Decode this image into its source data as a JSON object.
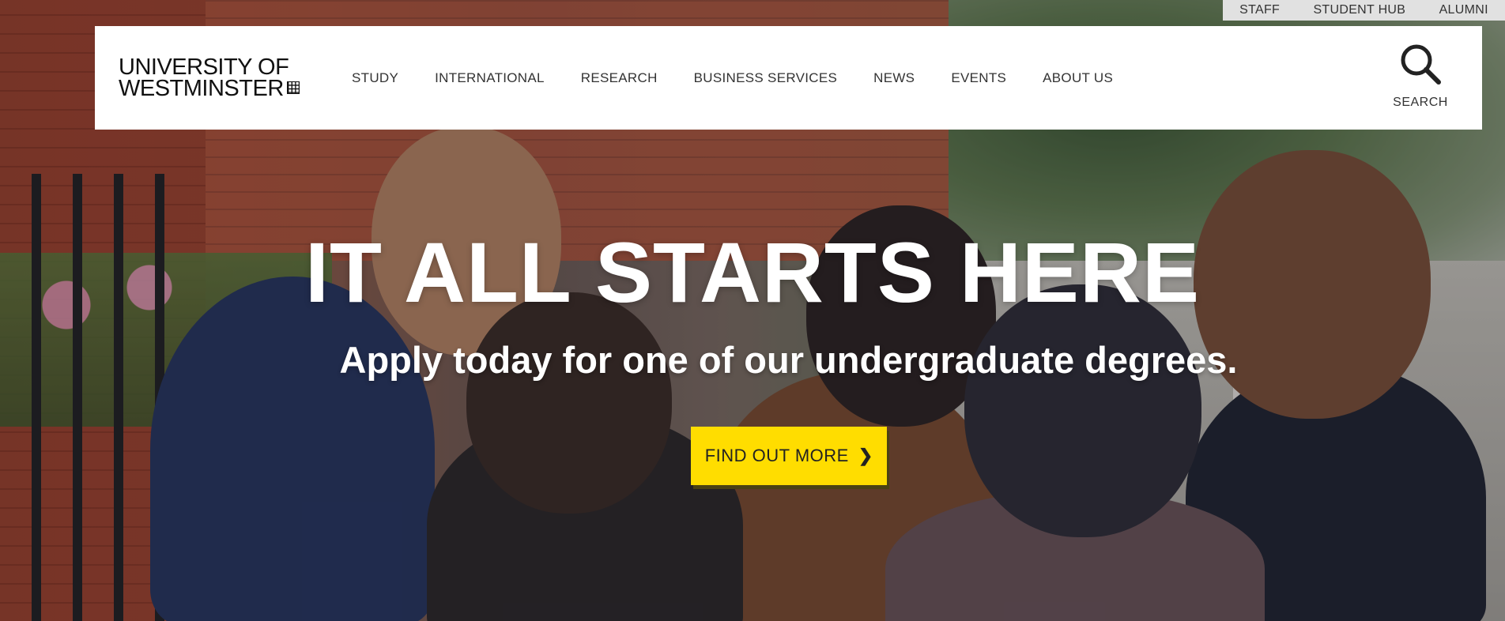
{
  "utility_nav": [
    "STAFF",
    "STUDENT HUB",
    "ALUMNI"
  ],
  "logo": {
    "line1": "UNIVERSITY OF",
    "line2": "WESTMINSTER"
  },
  "main_nav": [
    "STUDY",
    "INTERNATIONAL",
    "RESEARCH",
    "BUSINESS SERVICES",
    "NEWS",
    "EVENTS",
    "ABOUT US"
  ],
  "search": {
    "label": "SEARCH",
    "icon": "search-icon"
  },
  "hero": {
    "headline": "IT ALL STARTS HERE",
    "subheadline": "Apply today for one of our undergraduate degrees.",
    "cta_label": "FIND OUT MORE",
    "cta_icon": "chevron-right-icon"
  },
  "colors": {
    "cta": "#ffdd00",
    "header_bg": "#ffffff",
    "utility_bg": "#e1e1e1"
  }
}
